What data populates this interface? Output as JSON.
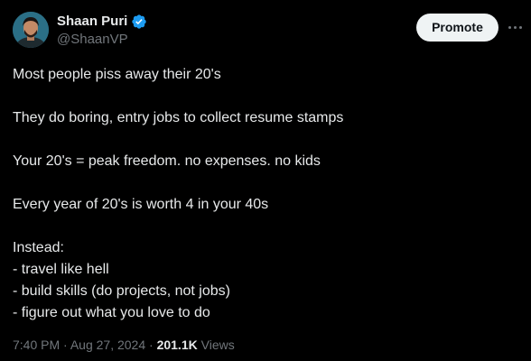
{
  "author": {
    "display_name": "Shaan Puri",
    "handle": "@ShaanVP",
    "verified": true,
    "verified_color": "#1d9bf0"
  },
  "header": {
    "promote_label": "Promote",
    "more_icon": "more-horizontal-icon"
  },
  "tweet": {
    "lines": [
      "Most people piss away their 20's",
      "",
      "They do boring, entry jobs to collect resume stamps",
      "",
      "Your 20's = peak freedom. no expenses. no kids",
      "",
      "Every year of 20's is worth 4 in your 40s",
      "",
      "Instead:",
      "- travel like hell",
      "- build skills (do projects, not jobs)",
      "- figure out what you love to do"
    ]
  },
  "meta": {
    "time": "7:40 PM",
    "separator": "·",
    "date": "Aug 27, 2024",
    "views_count": "201.1K",
    "views_label": "Views"
  }
}
